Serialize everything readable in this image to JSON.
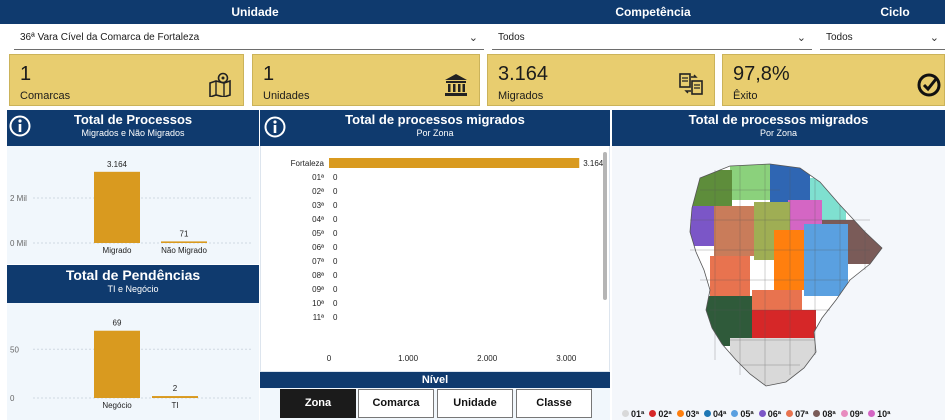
{
  "header": {
    "unidade_label": "Unidade",
    "competencia_label": "Competência",
    "ciclo_label": "Ciclo"
  },
  "slicers": {
    "unidade_value": "36ª Vara Cível da Comarca de Fortaleza",
    "competencia_value": "Todos",
    "ciclo_value": "Todos"
  },
  "cards": [
    {
      "value": "1",
      "label": "Comarcas",
      "icon": "map-location-icon"
    },
    {
      "value": "1",
      "label": "Unidades",
      "icon": "courthouse-icon"
    },
    {
      "value": "3.164",
      "label": "Migrados",
      "icon": "documents-transfer-icon"
    },
    {
      "value": "97,8%",
      "label": "Êxito",
      "icon": "check-circle-icon"
    }
  ],
  "panel_processos": {
    "title": "Total de Processos",
    "subtitle": "Migrados e Não Migrados"
  },
  "panel_pendencias": {
    "title": "Total de Pendências",
    "subtitle": "TI e Negócio"
  },
  "panel_zona": {
    "title": "Total de processos migrados",
    "subtitle": "Por Zona"
  },
  "panel_mapa": {
    "title": "Total de processos migrados",
    "subtitle": "Por Zona"
  },
  "nivel": {
    "title": "Nível",
    "buttons": [
      "Zona",
      "Comarca",
      "Unidade",
      "Classe"
    ],
    "active": "Zona"
  },
  "legend": [
    {
      "label": "01ª",
      "color": "#d9d9d9"
    },
    {
      "label": "02ª",
      "color": "#d62728"
    },
    {
      "label": "03ª",
      "color": "#ff7f0e"
    },
    {
      "label": "04ª",
      "color": "#1f77b4"
    },
    {
      "label": "05ª",
      "color": "#5aa0e0"
    },
    {
      "label": "06ª",
      "color": "#7b56c7"
    },
    {
      "label": "07ª",
      "color": "#e8734f"
    },
    {
      "label": "08ª",
      "color": "#7a5b58"
    },
    {
      "label": "09ª",
      "color": "#e88cbf"
    },
    {
      "label": "10ª",
      "color": "#d466c4"
    }
  ],
  "colors": {
    "navy": "#0f3a6e",
    "gold": "#d99a1f",
    "card": "#e8cd6f"
  },
  "chart_data": [
    {
      "type": "bar",
      "title": "Total de Processos",
      "subtitle": "Migrados e Não Migrados",
      "categories": [
        "Migrado",
        "Não Migrado"
      ],
      "values": [
        3164,
        71
      ],
      "value_labels": [
        "3.164",
        "71"
      ],
      "y_ticks": [
        "0 Mil",
        "2 Mil"
      ],
      "ylim": [
        0,
        3600
      ]
    },
    {
      "type": "bar",
      "title": "Total de Pendências",
      "subtitle": "TI e Negócio",
      "categories": [
        "Negócio",
        "TI"
      ],
      "values": [
        69,
        2
      ],
      "value_labels": [
        "69",
        "2"
      ],
      "y_ticks": [
        "0",
        "50"
      ],
      "ylim": [
        0,
        80
      ]
    },
    {
      "type": "bar",
      "orientation": "horizontal",
      "title": "Total de processos migrados",
      "subtitle": "Por Zona",
      "categories": [
        "Fortaleza",
        "01ª",
        "02ª",
        "03ª",
        "04ª",
        "05ª",
        "06ª",
        "07ª",
        "08ª",
        "09ª",
        "10ª",
        "11ª"
      ],
      "values": [
        3164,
        0,
        0,
        0,
        0,
        0,
        0,
        0,
        0,
        0,
        0,
        0
      ],
      "value_labels": [
        "3.164",
        "0",
        "0",
        "0",
        "0",
        "0",
        "0",
        "0",
        "0",
        "0",
        "0",
        "0"
      ],
      "x_ticks": [
        "0",
        "1.000",
        "2.000",
        "3.000"
      ],
      "x_tick_values": [
        0,
        1000,
        2000,
        3000
      ],
      "xlim": [
        0,
        3300
      ]
    }
  ]
}
